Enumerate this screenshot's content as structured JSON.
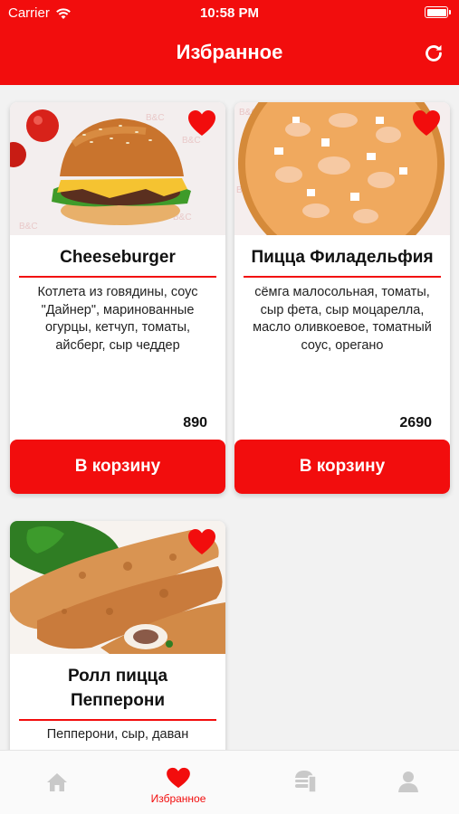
{
  "status": {
    "carrier": "Carrier",
    "time": "10:58 PM"
  },
  "header": {
    "title": "Избранное",
    "refresh_icon": "refresh-icon"
  },
  "items": [
    {
      "title": "Cheeseburger",
      "description": "Котлета из говядины, соус \"Дайнер\", маринованные огурцы, кетчуп, томаты, айсберг, сыр чеддер",
      "price": "890",
      "button": "В корзину",
      "favorite": true
    },
    {
      "title": "Пицца Филадельфия",
      "description": "сёмга малосольная, томаты, сыр фета, сыр моцарелла, масло оливкоевое, томатный соус, орегано",
      "price": "2690",
      "button": "В корзину",
      "favorite": true
    },
    {
      "title": "Ролл пицца Пепперони",
      "description": "Пепперони, сыр, даван",
      "favorite": true
    }
  ],
  "tabs": [
    {
      "icon": "home-icon",
      "label": ""
    },
    {
      "icon": "heart-icon",
      "label": "Избранное",
      "active": true
    },
    {
      "icon": "menu-food-icon",
      "label": ""
    },
    {
      "icon": "profile-icon",
      "label": ""
    }
  ],
  "colors": {
    "accent": "#f20d0d",
    "inactive_icon": "#c9c9c9"
  }
}
